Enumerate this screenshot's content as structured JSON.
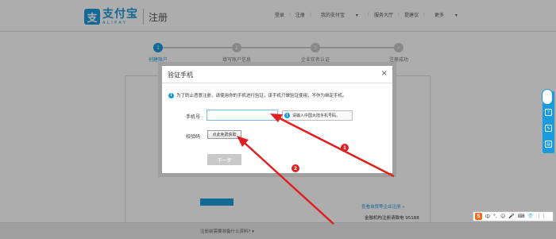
{
  "header": {
    "logo_mark": "支",
    "logo_cn": "支付宝",
    "logo_en": "ALIPAY",
    "page_label": "注册",
    "nav": [
      "登录",
      "注册",
      "我的支付宝",
      "服务大厅",
      "提建议",
      "更多"
    ]
  },
  "steps": [
    {
      "num": "1",
      "label": "创建账户",
      "active": true
    },
    {
      "num": "2",
      "label": "填写账户信息",
      "active": false
    },
    {
      "num": "3",
      "label": "企业实名认证",
      "active": false
    },
    {
      "num": "✓",
      "label": "注册成功",
      "active": false
    }
  ],
  "card": {
    "link1": "查看自贸等企业注册 »",
    "link2": "金融机构注册请致电 95188"
  },
  "footer": {
    "text": "注册前需要准备什么资料? ▾"
  },
  "dialog": {
    "title": "验证手机",
    "close": "×",
    "notice": "为了防止恶意注册，请使用你的手机进行验证，该手机只做验证使用，不作为绑定手机。",
    "phone_label": "手机号",
    "phone_value": "",
    "phone_tip": "请输入中国大陆手机号码。",
    "code_label": "校验码",
    "code_button": "点此免费获取",
    "next_button": "下一步"
  },
  "annotations": [
    "1",
    "2"
  ],
  "ime": {
    "logo": "S",
    "items": [
      "中",
      "°,",
      "☺",
      "🎤",
      "⌨",
      "👕",
      "⋮⋮"
    ]
  },
  "colors": {
    "brand": "#1a9bde",
    "arrow": "#e02020",
    "disabled": "#c9c9c9"
  }
}
